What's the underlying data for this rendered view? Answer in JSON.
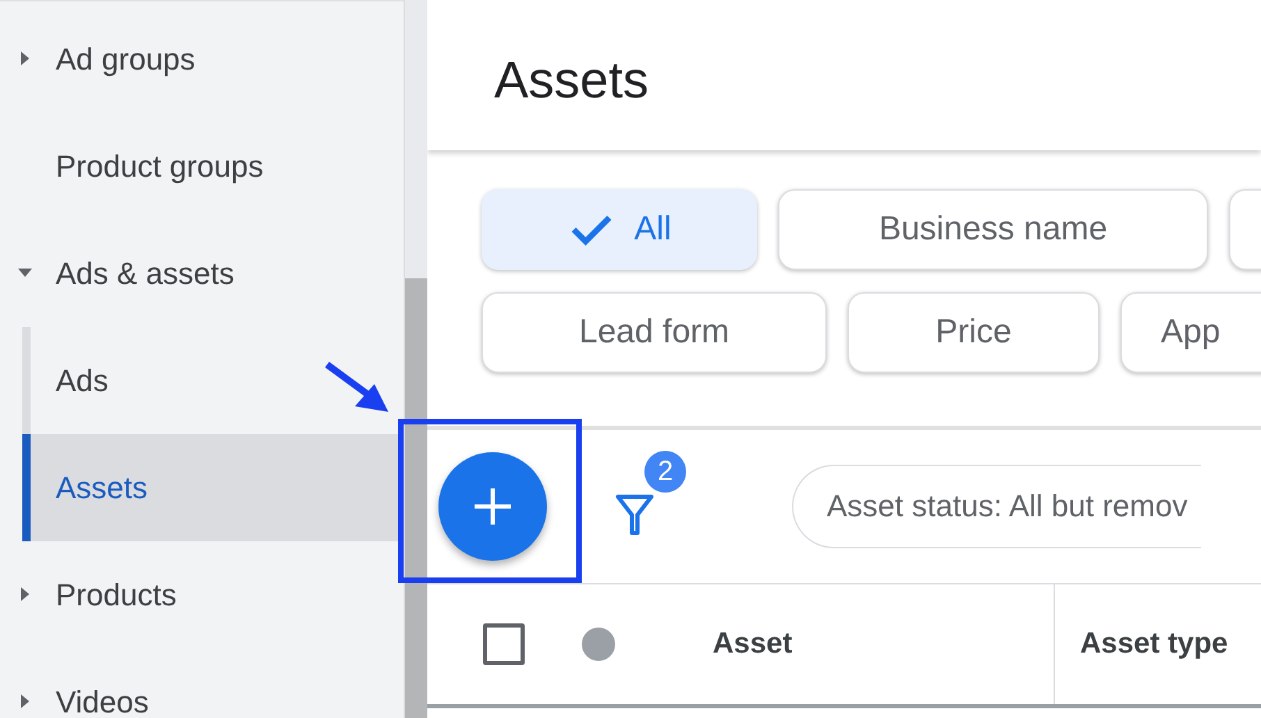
{
  "sidebar": {
    "items": [
      {
        "label": "Ad groups",
        "kind": "group",
        "expanded": false,
        "selected": false
      },
      {
        "label": "Product groups",
        "kind": "leaf",
        "selected": false
      },
      {
        "label": "Ads & assets",
        "kind": "group",
        "expanded": true,
        "selected": false,
        "children": [
          {
            "label": "Ads",
            "selected": false
          },
          {
            "label": "Assets",
            "selected": true
          }
        ]
      },
      {
        "label": "Products",
        "kind": "group",
        "expanded": false,
        "selected": false
      },
      {
        "label": "Videos",
        "kind": "group",
        "expanded": false,
        "selected": false
      }
    ]
  },
  "page": {
    "title": "Assets"
  },
  "type_chips": [
    [
      {
        "label": "All",
        "selected": true
      },
      {
        "label": "Business name",
        "selected": false
      },
      {
        "selected": false
      }
    ],
    [
      {
        "label": "Lead form",
        "selected": false
      },
      {
        "label": "Price",
        "selected": false
      },
      {
        "label": "App",
        "selected": false
      }
    ]
  ],
  "toolbar": {
    "filter_count": "2",
    "filter_chip": "Asset status: All but remov"
  },
  "table": {
    "select_all": {
      "checked": false
    },
    "columns": [
      "Asset",
      "Asset type"
    ]
  }
}
